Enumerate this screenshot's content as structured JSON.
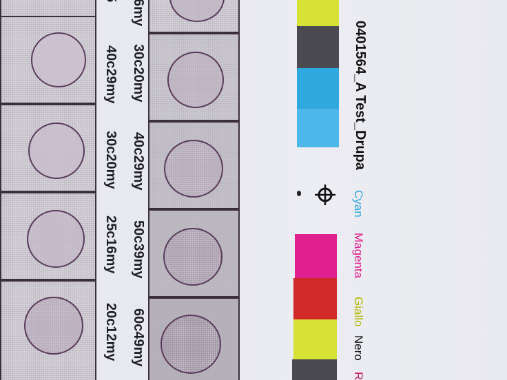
{
  "swatch_labels": {
    "col1_top": "5",
    "col1_a": "40c29my",
    "col1_b": "30c20my",
    "col1_c": "25c16my",
    "col1_d": "20c12my",
    "col2_top": "6my",
    "col2_a": "30c20my",
    "col2_b": "40c29my",
    "col2_c": "50c39my",
    "col2_d": "60c49my"
  },
  "job_title": "0401564_A Test_Drupa",
  "color_names": {
    "cyan": "Cyan",
    "magenta": "Magenta",
    "yellow": "Giallo",
    "black": "Nero",
    "red": "R"
  },
  "colors": {
    "cyan": "#2fa8e0",
    "magenta": "#e0208f",
    "red": "#d22a2a",
    "yellow": "#d6e236",
    "black": "#4a4a50",
    "giallo_text": "#b4b600",
    "nero_text": "#111111",
    "red_text": "#c21e6a"
  }
}
